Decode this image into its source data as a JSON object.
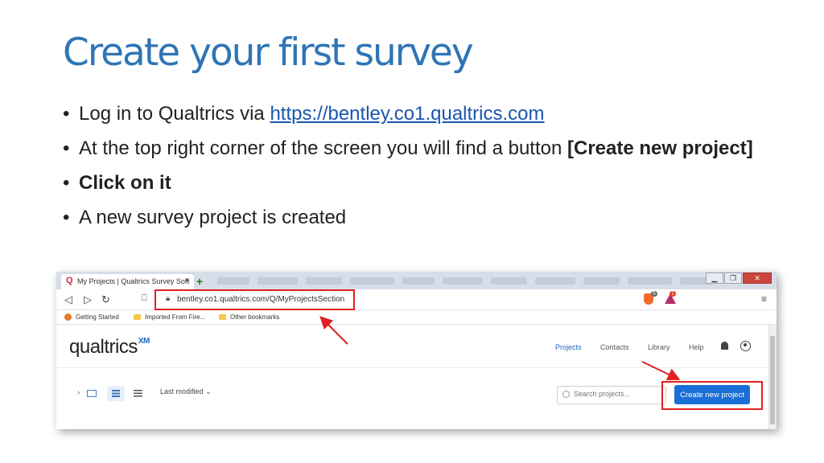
{
  "slide": {
    "title": "Create your first survey",
    "bullets": {
      "b1_text": "Log in to Qualtrics via ",
      "b1_link": "https://bentley.co1.qualtrics.com",
      "b2_text": "At the top right corner of the screen you will find a button ",
      "b2_bold": "[Create new project]",
      "b3_bold": "Click on it",
      "b4_text": "A new survey project is created"
    }
  },
  "browser": {
    "tab_title": "My Projects | Qualtrics Survey Soft",
    "tab_favicon": "Q",
    "tab_close": "×",
    "new_tab": "+",
    "url": "bentley.co1.qualtrics.com/Q/MyProjectsSection",
    "brave_badge": "5",
    "rewards_badge": "1",
    "bookmarks": [
      "Getting Started",
      "Imported From Fire...",
      "Other bookmarks"
    ],
    "window_controls": [
      "▁",
      "❐",
      "✕"
    ]
  },
  "qualtrics": {
    "logo": "qualtrics",
    "logo_sup": "XM",
    "nav": [
      "Projects",
      "Contacts",
      "Library",
      "Help"
    ],
    "sort_label": "Last modified",
    "sort_caret": "⌄",
    "search_placeholder": "Search projects...",
    "create_button": "Create new project"
  },
  "colors": {
    "title": "#2e75b6",
    "link": "#1a56b0",
    "highlight": "#e02020",
    "primary_button": "#1a6fd6"
  }
}
